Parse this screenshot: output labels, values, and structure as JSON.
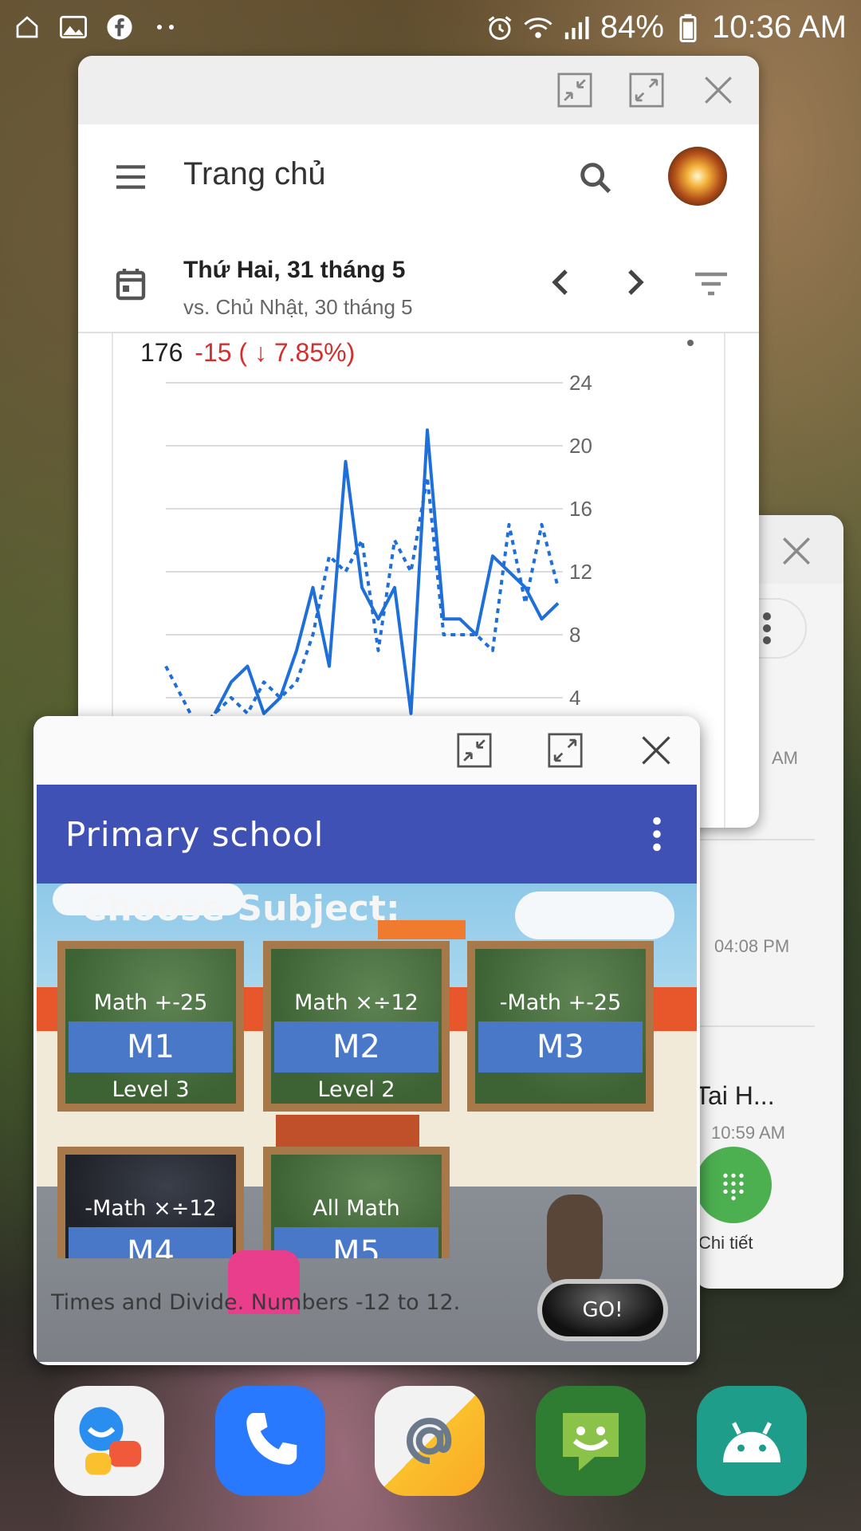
{
  "status_bar": {
    "battery": "84%",
    "time": "10:36 AM",
    "left_icons": [
      "home-icon",
      "gallery-icon",
      "facebook-icon",
      "more-dots-icon"
    ],
    "right_icons": [
      "alarm-icon",
      "wifi-icon",
      "signal-icon",
      "battery-icon"
    ]
  },
  "analytics_window": {
    "app_bar": {
      "title": "Trang chủ"
    },
    "date_bar": {
      "date": "Thứ Hai, 31 tháng 5",
      "compare": "vs. Chủ Nhật, 30 tháng 5"
    },
    "summary": {
      "value": "176",
      "delta": "-15 ( ↓ 7.85%)"
    },
    "chart_data": {
      "type": "line",
      "y_ticks": [
        "24",
        "20",
        "16",
        "12",
        "8",
        "4"
      ],
      "ylim": [
        4,
        24
      ],
      "series": [
        {
          "style": "solid",
          "values": [
            null,
            null,
            null,
            3,
            5,
            6,
            3,
            4,
            7,
            11,
            6,
            19,
            11,
            9,
            11,
            3,
            21,
            9,
            9,
            8,
            13,
            12,
            11,
            9,
            10
          ]
        },
        {
          "style": "dotted",
          "values": [
            6,
            4,
            2,
            3,
            4,
            3,
            5,
            4,
            5,
            8,
            13,
            12,
            14,
            7,
            14,
            12,
            18,
            8,
            8,
            8,
            7,
            15,
            10,
            15,
            11
          ]
        }
      ],
      "colors": {
        "line": "#1e6fd9"
      }
    }
  },
  "side_window": {
    "times": [
      "AM",
      "04:08 PM",
      "10:59 AM"
    ],
    "partial_text": "Tai H...",
    "fab_label": "Chi tiết"
  },
  "game_window": {
    "title": "Primary school",
    "scene_heading": "Choose Subject:",
    "boards": [
      {
        "subject": "Math +-25",
        "code": "M1",
        "level": "Level 3"
      },
      {
        "subject": "Math ×÷12",
        "code": "M2",
        "level": "Level 2"
      },
      {
        "subject": "-Math +-25",
        "code": "M3",
        "level": ""
      },
      {
        "subject": "-Math ×÷12",
        "code": "M4",
        "level": ""
      },
      {
        "subject": "All Math",
        "code": "M5",
        "level": ""
      }
    ],
    "description": "Times and Divide. Numbers -12 to 12.",
    "go_label": "GO!"
  },
  "dock": {
    "apps": [
      "messenger-app",
      "phone-app",
      "email-app",
      "messages-app",
      "android-app"
    ]
  },
  "colors": {
    "chart_line": "#1e6fd9",
    "delta_red": "#d32f2f",
    "game_appbar": "#3f51b5",
    "board_code": "#4a78c8"
  }
}
